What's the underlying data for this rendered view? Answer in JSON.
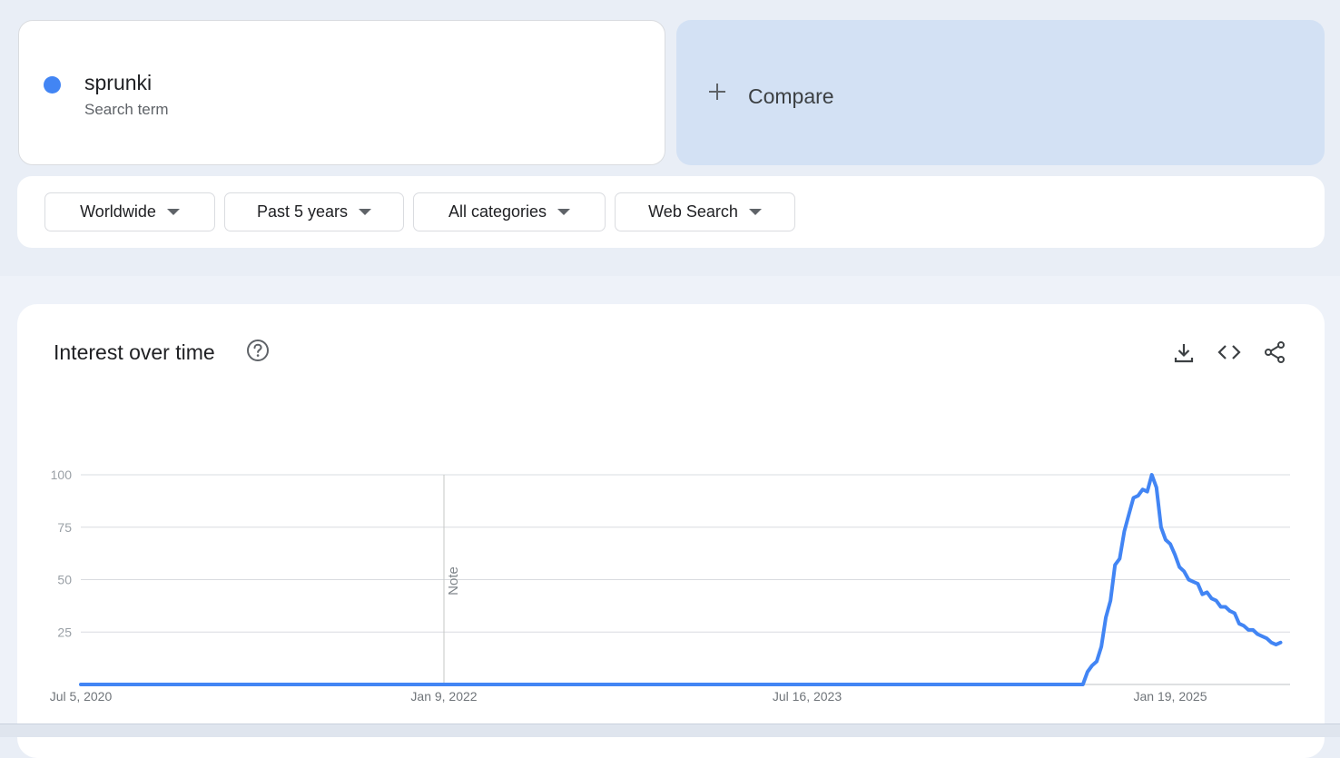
{
  "search_term": {
    "name": "sprunki",
    "subtitle": "Search term",
    "color": "#4285f4"
  },
  "compare": {
    "label": "Compare"
  },
  "filters": {
    "region": "Worldwide",
    "time": "Past 5 years",
    "category": "All categories",
    "search_type": "Web Search"
  },
  "panel": {
    "title": "Interest over time",
    "help_icon": "help-circle-icon",
    "actions": [
      "download-icon",
      "embed-code-icon",
      "share-icon"
    ]
  },
  "chart_data": {
    "type": "line",
    "title": "",
    "xlabel": "",
    "ylabel": "",
    "ylim": [
      0,
      100
    ],
    "yticks": [
      25,
      50,
      75,
      100
    ],
    "xticks": [
      {
        "label": "Jul 5, 2020",
        "date": "2020-07-05"
      },
      {
        "label": "Jan 9, 2022",
        "date": "2022-01-09"
      },
      {
        "label": "Jul 16, 2023",
        "date": "2023-07-16"
      },
      {
        "label": "Jan 19, 2025",
        "date": "2025-01-19"
      }
    ],
    "xlim": [
      "2020-07-05",
      "2025-06-29"
    ],
    "annotation": {
      "label": "Note",
      "date": "2022-01-09"
    },
    "grid": true,
    "series": [
      {
        "name": "sprunki",
        "color": "#4285f4",
        "points": [
          [
            "2020-07-05",
            0
          ],
          [
            "2024-09-08",
            0
          ],
          [
            "2024-09-15",
            6
          ],
          [
            "2024-09-22",
            9
          ],
          [
            "2024-09-29",
            11
          ],
          [
            "2024-10-06",
            18
          ],
          [
            "2024-10-13",
            32
          ],
          [
            "2024-10-20",
            40
          ],
          [
            "2024-10-27",
            57
          ],
          [
            "2024-11-03",
            60
          ],
          [
            "2024-11-10",
            73
          ],
          [
            "2024-11-17",
            81
          ],
          [
            "2024-11-24",
            89
          ],
          [
            "2024-12-01",
            90
          ],
          [
            "2024-12-08",
            93
          ],
          [
            "2024-12-15",
            92
          ],
          [
            "2024-12-22",
            100
          ],
          [
            "2024-12-29",
            94
          ],
          [
            "2025-01-05",
            75
          ],
          [
            "2025-01-12",
            69
          ],
          [
            "2025-01-19",
            67
          ],
          [
            "2025-01-26",
            62
          ],
          [
            "2025-02-02",
            56
          ],
          [
            "2025-02-09",
            54
          ],
          [
            "2025-02-16",
            50
          ],
          [
            "2025-02-23",
            49
          ],
          [
            "2025-03-02",
            48
          ],
          [
            "2025-03-09",
            43
          ],
          [
            "2025-03-16",
            44
          ],
          [
            "2025-03-23",
            41
          ],
          [
            "2025-03-30",
            40
          ],
          [
            "2025-04-06",
            37
          ],
          [
            "2025-04-13",
            37
          ],
          [
            "2025-04-20",
            35
          ],
          [
            "2025-04-27",
            34
          ],
          [
            "2025-05-04",
            29
          ],
          [
            "2025-05-11",
            28
          ],
          [
            "2025-05-18",
            26
          ],
          [
            "2025-05-25",
            26
          ],
          [
            "2025-06-01",
            24
          ],
          [
            "2025-06-08",
            23
          ],
          [
            "2025-06-15",
            22
          ],
          [
            "2025-06-22",
            20
          ],
          [
            "2025-06-29",
            19
          ],
          [
            "2025-07-06",
            20
          ]
        ]
      }
    ]
  }
}
